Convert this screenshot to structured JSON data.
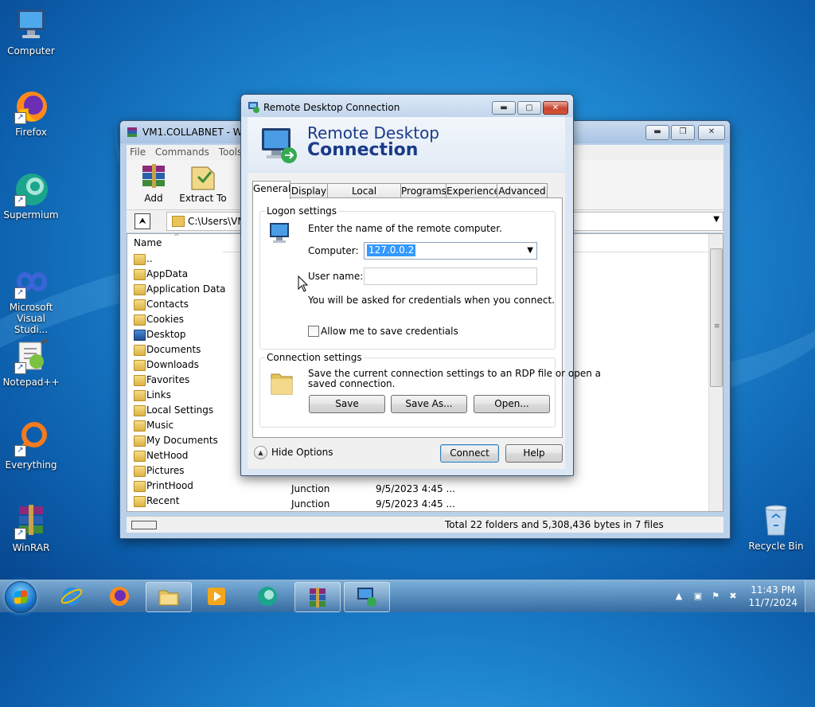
{
  "desktop": {
    "icons": [
      {
        "label": "Computer",
        "icon": "computer-icon"
      },
      {
        "label": "Firefox",
        "icon": "firefox-icon"
      },
      {
        "label": "Supermium",
        "icon": "supermium-icon"
      },
      {
        "label_line1": "Microsoft",
        "label_line2": "Visual Studi...",
        "icon": "visual-studio-icon"
      },
      {
        "label": "Notepad++",
        "icon": "notepadpp-icon"
      },
      {
        "label": "Everything",
        "icon": "everything-icon"
      },
      {
        "label": "WinRAR",
        "icon": "winrar-icon"
      },
      {
        "label": "Recycle Bin",
        "icon": "recycle-bin-icon"
      }
    ]
  },
  "winrar": {
    "title": "VM1.COLLABNET - Wi",
    "menu": [
      "File",
      "Commands",
      "Tools"
    ],
    "toolbar": {
      "add": "Add",
      "extract": "Extract To"
    },
    "address": "C:\\Users\\VM",
    "column_name": "Name",
    "files": [
      "..",
      "AppData",
      "Application Data",
      "Contacts",
      "Cookies",
      "Desktop",
      "Documents",
      "Downloads",
      "Favorites",
      "Links",
      "Local Settings",
      "Music",
      "My Documents",
      "NetHood",
      "Pictures",
      "PrintHood",
      "Recent"
    ],
    "visible_rows": [
      {
        "type": "Junction",
        "date": "9/5/2023 4:45 ..."
      },
      {
        "type": "Junction",
        "date": "9/5/2023 4:45 ..."
      }
    ],
    "status": "Total 22 folders and 5,308,436 bytes in 7 files"
  },
  "rdp": {
    "title": "Remote Desktop Connection",
    "banner_line1": "Remote Desktop",
    "banner_line2": "Connection",
    "tabs": [
      "General",
      "Display",
      "Local Resources",
      "Programs",
      "Experience",
      "Advanced"
    ],
    "active_tab": "General",
    "logon": {
      "group_label": "Logon settings",
      "instruction": "Enter the name of the remote computer.",
      "computer_label": "Computer:",
      "computer_value": "127.0.0.2",
      "username_label": "User name:",
      "username_value": "",
      "credentials_note": "You will be asked for credentials when you connect.",
      "allow_save_label": "Allow me to save credentials",
      "allow_save_checked": false
    },
    "connection": {
      "group_label": "Connection settings",
      "desc_line1": "Save the current connection settings to an RDP file or open a",
      "desc_line2": "saved connection.",
      "save": "Save",
      "save_as": "Save As...",
      "open": "Open..."
    },
    "hide_options": "Hide Options",
    "connect": "Connect",
    "help": "Help"
  },
  "taskbar": {
    "time": "11:43 PM",
    "date": "11/7/2024",
    "items": [
      "internet-explorer-icon",
      "firefox-icon",
      "file-explorer-icon",
      "media-player-icon",
      "supermium-icon",
      "winrar-icon",
      "remote-desktop-icon"
    ]
  }
}
